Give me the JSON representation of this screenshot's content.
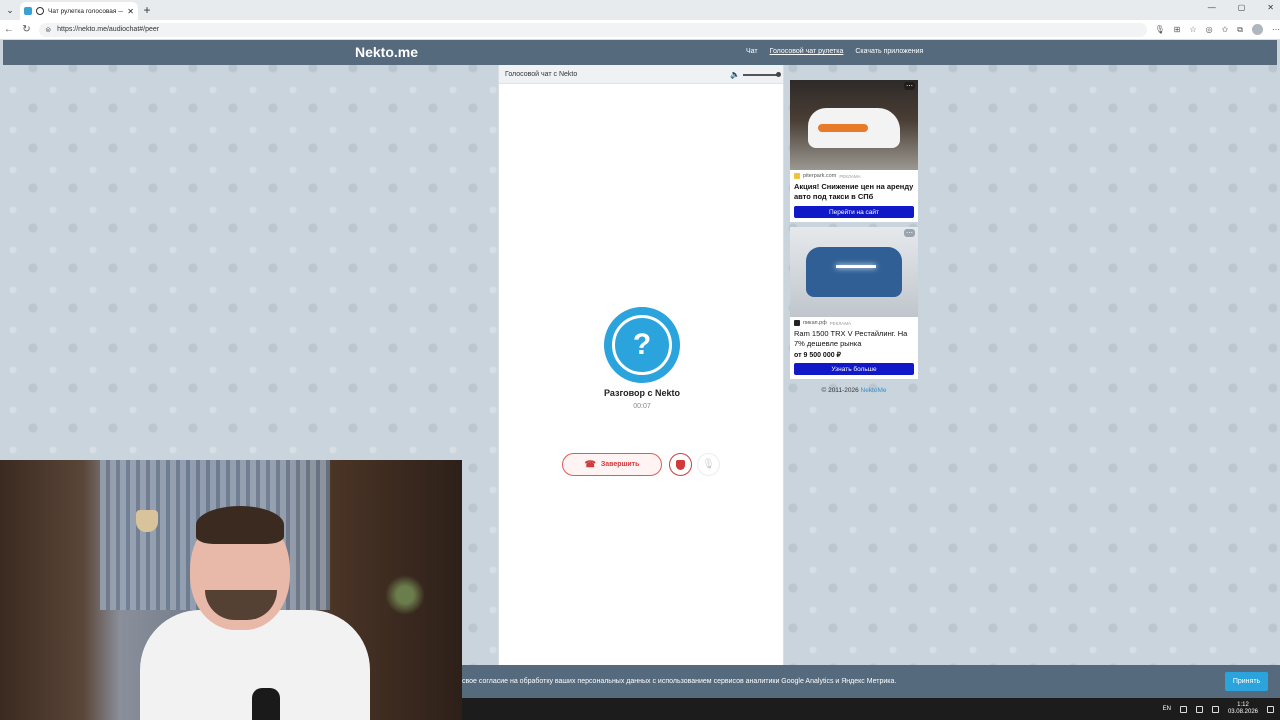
{
  "browser": {
    "tab_title": "Чат рулетка голосовая — Ne",
    "tab_close": "✕",
    "new_tab": "+",
    "url": "https://nekto.me/audiochat#/peer"
  },
  "site": {
    "logo": "Nekto.me",
    "nav": [
      "Чат",
      "Голосовой чат рулетка",
      "Скачать приложения"
    ]
  },
  "chat": {
    "header_title": "Голосовой чат с Nekto",
    "avatar_symbol": "?",
    "peer_name": "Разговор с Nekto",
    "timer": "00:07",
    "end_label": "Завершить"
  },
  "ads": [
    {
      "source": "piterpark.com",
      "tag": "РЕКЛАМА",
      "title": "Акция! Снижение цен на аренду авто под такси в СПб",
      "price": "",
      "cta": "Перейти на сайт"
    },
    {
      "source": "пикап.рф",
      "tag": "РЕКЛАМА",
      "title": "Ram 1500 TRX V Рестайлинг. На 7% дешевле рынка",
      "price": "от 9 500 000 ₽",
      "cta": "Узнать больше"
    }
  ],
  "footer": {
    "copyright": "© 2011-2026 ",
    "link": "NektoMe"
  },
  "cookie": {
    "text": "свое согласие на обработку ваших персональных данных с использованием сервисов аналитики Google Analytics и Яндекс Метрика.",
    "accept": "Принять"
  },
  "taskbar": {
    "lang": "EN",
    "time": "1:12",
    "date": "03.08.2026"
  },
  "colors": {
    "header": "#566a7e",
    "accent": "#2ba3dd",
    "end_call": "#d23a3a",
    "ad_cta": "#1018c8"
  }
}
